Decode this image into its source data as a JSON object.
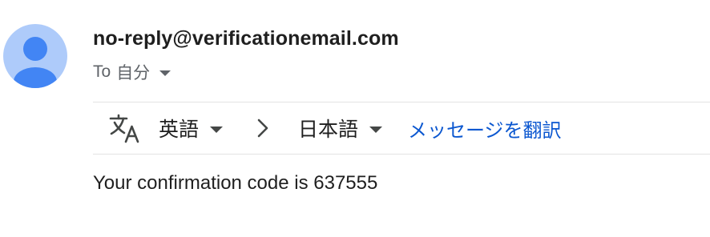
{
  "sender": {
    "email": "no-reply@verificationemail.com",
    "avatar_icon": "person-avatar-icon",
    "avatar_bg": "#aecbfa",
    "avatar_fg": "#4285f4"
  },
  "recipient": {
    "to_label": "To",
    "name": "自分",
    "details_icon": "caret-down-icon"
  },
  "translate_bar": {
    "icon": "translate-icon",
    "source_lang": "英語",
    "target_lang": "日本語",
    "arrow_icon": "chevron-right-icon",
    "translate_link": "メッセージを翻訳",
    "link_color": "#0b57d0"
  },
  "message": {
    "body": "Your confirmation code is 637555"
  }
}
